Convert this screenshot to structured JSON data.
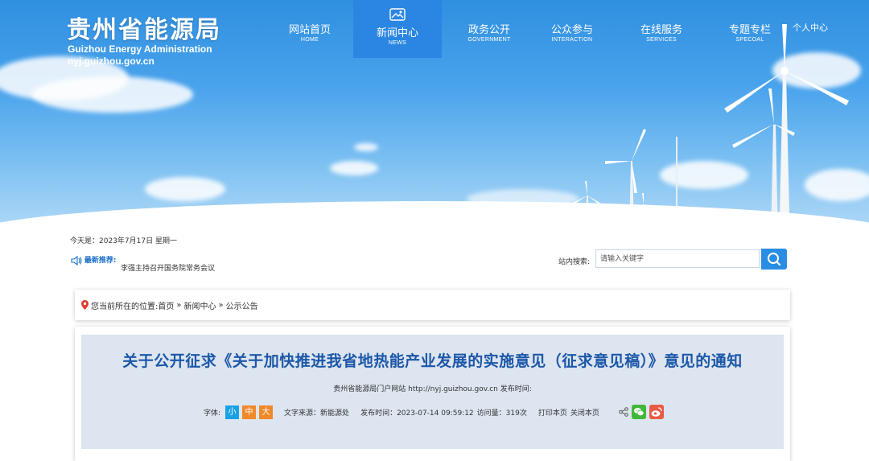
{
  "site": {
    "name_cn": "贵州省能源局",
    "name_en": "Guizhou Energy Administration",
    "domain": "nyj.guizhou.gov.cn"
  },
  "nav": {
    "items": [
      {
        "label": "网站首页",
        "sub": "HOME"
      },
      {
        "label": "新闻中心",
        "sub": "NEWS",
        "active": true,
        "icon": "image-icon"
      },
      {
        "label": "政务公开",
        "sub": "GOVERNMENT"
      },
      {
        "label": "公众参与",
        "sub": "INTERACTION"
      },
      {
        "label": "在线服务",
        "sub": "SERVICES"
      },
      {
        "label": "专题专栏",
        "sub": "SPECOAL"
      }
    ],
    "personal": "个人中心",
    "active_color": "#2a86e2"
  },
  "info": {
    "today": "今天是：2023年7月17日 星期一",
    "recommend_label": "最新推荐:",
    "recommend_text": "李强主持召开国务院常务会议"
  },
  "search": {
    "label": "站内搜索:",
    "placeholder": "请输入关键字",
    "button_icon": "search-icon"
  },
  "breadcrumb": {
    "prefix": "您当前所在的位置:",
    "items": [
      "首页",
      "新闻中心",
      "公示公告"
    ],
    "separator": "»"
  },
  "article": {
    "title": "关于公开征求《关于加快推进我省地热能产业发展的实施意见（征求意见稿）》意见的通知",
    "meta_line": "贵州省能源局门户网站  http://nyj.guizhou.gov.cn  发布时间:",
    "font_label": "字体:",
    "font_sizes": [
      "小",
      "中",
      "大"
    ],
    "source": "文字来源：新能源处",
    "publish_time": "发布时间：2023-07-14 09:59:12",
    "views": "访问量：319次",
    "print": "打印本页",
    "close": "关闭本页",
    "title_color": "#1c57a8"
  }
}
